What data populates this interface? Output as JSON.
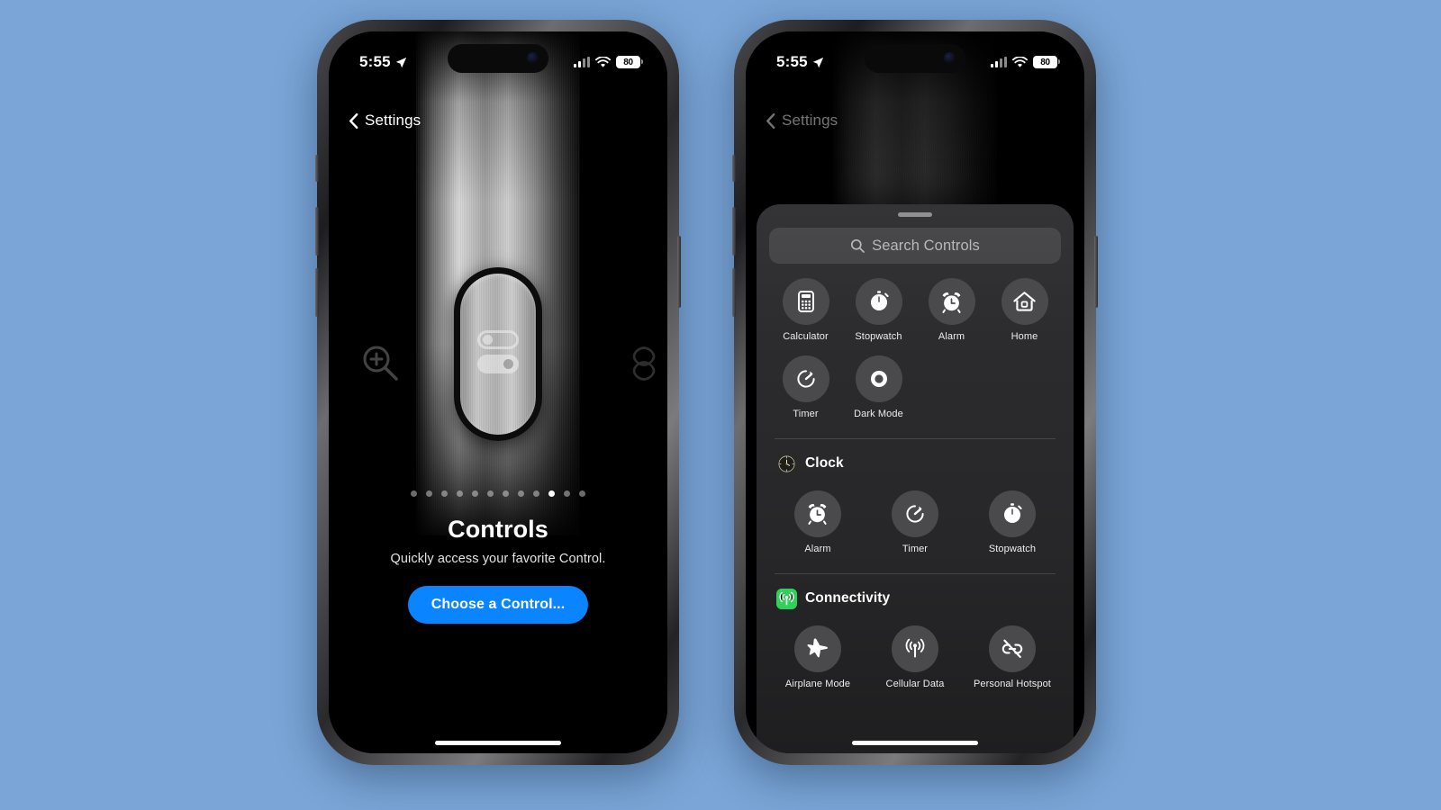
{
  "background_color": "#7aa5d6",
  "accent_color": "#0a84ff",
  "phones": {
    "left": {
      "status_bar": {
        "time": "5:55",
        "battery": "80",
        "location_icon": "location-arrow-icon",
        "signal_icon": "cellular-bars-icon",
        "wifi_icon": "wifi-icon"
      },
      "nav": {
        "back_label": "Settings",
        "back_icon": "chevron-left-icon"
      },
      "hero": {
        "title": "Controls",
        "subtitle": "Quickly access your favorite Control.",
        "cta_label": "Choose a Control...",
        "left_icon": "magnifier-plus-icon",
        "right_icon": "shapes-icon",
        "pager": {
          "total": 12,
          "active_index": 10
        }
      }
    },
    "right": {
      "status_bar": {
        "time": "5:55",
        "battery": "80",
        "location_icon": "location-arrow-icon",
        "signal_icon": "cellular-bars-icon",
        "wifi_icon": "wifi-icon"
      },
      "nav": {
        "back_label": "Settings",
        "back_icon": "chevron-left-icon"
      },
      "sheet": {
        "search": {
          "placeholder": "Search Controls",
          "value": "",
          "icon": "search-icon"
        },
        "sections": [
          {
            "id": "suggested",
            "title": "",
            "icon": "",
            "columns": 4,
            "items": [
              {
                "label": "Calculator",
                "icon": "calculator-icon"
              },
              {
                "label": "Stopwatch",
                "icon": "stopwatch-icon"
              },
              {
                "label": "Alarm",
                "icon": "alarm-clock-icon"
              },
              {
                "label": "Home",
                "icon": "home-house-icon"
              },
              {
                "label": "Timer",
                "icon": "timer-icon"
              },
              {
                "label": "Dark Mode",
                "icon": "dark-mode-contrast-icon"
              }
            ]
          },
          {
            "id": "clock",
            "title": "Clock",
            "icon": "clock-app-icon",
            "columns": 3,
            "items": [
              {
                "label": "Alarm",
                "icon": "alarm-clock-icon"
              },
              {
                "label": "Timer",
                "icon": "timer-icon"
              },
              {
                "label": "Stopwatch",
                "icon": "stopwatch-icon"
              }
            ]
          },
          {
            "id": "connectivity",
            "title": "Connectivity",
            "icon": "connectivity-app-icon",
            "icon_color": "#30d158",
            "columns": 3,
            "items": [
              {
                "label": "Airplane Mode",
                "icon": "airplane-icon"
              },
              {
                "label": "Cellular Data",
                "icon": "cellular-antenna-icon"
              },
              {
                "label": "Personal Hotspot",
                "icon": "hotspot-link-slash-icon"
              }
            ]
          }
        ]
      }
    }
  }
}
